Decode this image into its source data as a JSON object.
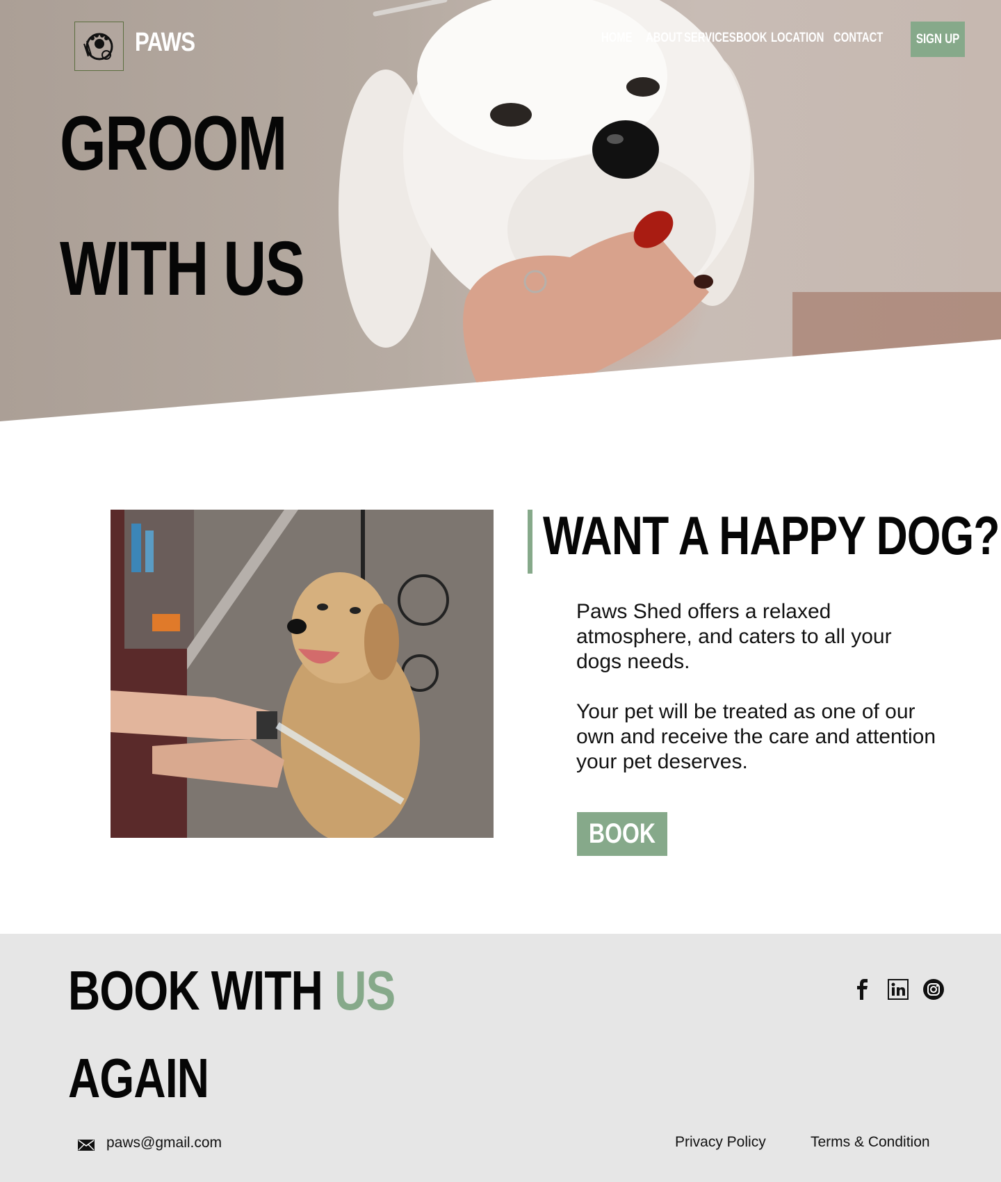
{
  "brand": {
    "name": "PAWS",
    "logo_icon": "dog-paw-logo-icon"
  },
  "nav": {
    "items": [
      {
        "label": "HOME"
      },
      {
        "label": "ABOUT"
      },
      {
        "label": "SERVICES"
      },
      {
        "label": "BOOK"
      },
      {
        "label": "LOCATION"
      },
      {
        "label": "CONTACT"
      }
    ],
    "signup_label": "SIGN UP"
  },
  "hero": {
    "title_line1": "GROOM",
    "title_line2": "WITH US",
    "image": "white-dog-being-groomed-photo"
  },
  "about": {
    "image": "golden-retriever-bath-photo",
    "title": "WANT A HAPPY DOG?",
    "paragraph1": "Paws Shed offers a relaxed atmosphere, and caters to all your dogs needs.",
    "paragraph2": "Your pet will be treated as one of our own and receive the care and attention your pet deserves.",
    "book_label": "BOOK"
  },
  "footer": {
    "title_part1": "BOOK WITH ",
    "title_accent": "US",
    "title_line2": "AGAIN",
    "social": [
      "facebook-icon",
      "linkedin-icon",
      "instagram-icon"
    ],
    "email": "paws@gmail.com",
    "links": [
      {
        "label": "Privacy Policy"
      },
      {
        "label": "Terms & Condition"
      }
    ]
  },
  "colors": {
    "accent": "#86a98a",
    "hero_bg": "#b6aba2",
    "footer_bg": "#e6e6e6",
    "text_dark": "#060606"
  }
}
